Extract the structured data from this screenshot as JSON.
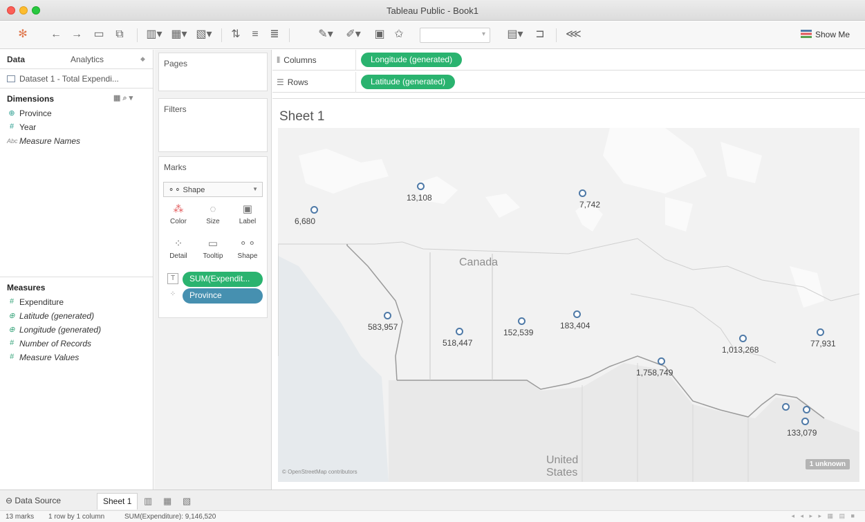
{
  "window": {
    "title": "Tableau Public - Book1"
  },
  "toolbar": {
    "show_me": "Show Me"
  },
  "data_pane": {
    "tabs": [
      "Data",
      "Analytics"
    ],
    "datasource": "Dataset 1 - Total Expendi...",
    "dimensions_header": "Dimensions",
    "dimensions": [
      {
        "name": "Province",
        "icon": "globe-icon"
      },
      {
        "name": "Year",
        "icon": "hash-icon"
      },
      {
        "name": "Measure Names",
        "icon": "abc-icon"
      }
    ],
    "measures_header": "Measures",
    "measures": [
      {
        "name": "Expenditure",
        "icon": "hash-icon"
      },
      {
        "name": "Latitude (generated)",
        "icon": "globe-icon"
      },
      {
        "name": "Longitude (generated)",
        "icon": "globe-icon"
      },
      {
        "name": "Number of Records",
        "icon": "hash-icon"
      },
      {
        "name": "Measure Values",
        "icon": "hash-icon"
      }
    ]
  },
  "cards": {
    "pages": "Pages",
    "filters": "Filters",
    "marks": "Marks",
    "mark_type": "Shape",
    "mark_buttons": [
      "Color",
      "Size",
      "Label",
      "Detail",
      "Tooltip",
      "Shape"
    ],
    "mark_pills": [
      "SUM(Expendit...",
      "Province"
    ]
  },
  "shelves": {
    "columns_label": "Columns",
    "columns_pill": "Longitude (generated)",
    "rows_label": "Rows",
    "rows_pill": "Latitude (generated)"
  },
  "viz": {
    "sheet_title": "Sheet 1",
    "map_labels": {
      "canada": "Canada",
      "us_line1": "United",
      "us_line2": "States"
    },
    "attribution": "© OpenStreetMap contributors",
    "unknown_badge": "1 unknown"
  },
  "chart_data": {
    "type": "scatter",
    "marks": [
      {
        "label": "6,680"
      },
      {
        "label": "13,108"
      },
      {
        "label": "7,742"
      },
      {
        "label": "583,957"
      },
      {
        "label": "518,447"
      },
      {
        "label": "152,539"
      },
      {
        "label": "183,404"
      },
      {
        "label": "1,758,749"
      },
      {
        "label": "1,013,268"
      },
      {
        "label": "77,931"
      },
      {
        "label": ""
      },
      {
        "label": ""
      },
      {
        "label": "133,079"
      }
    ],
    "mark_color": "#4e79a7"
  },
  "bottom": {
    "data_source_tab": "Data Source",
    "sheet_tab": "Sheet 1",
    "status_marks": "13 marks",
    "status_rows": "1 row by 1 column",
    "status_sum": "SUM(Expenditure): 9,146,520"
  }
}
